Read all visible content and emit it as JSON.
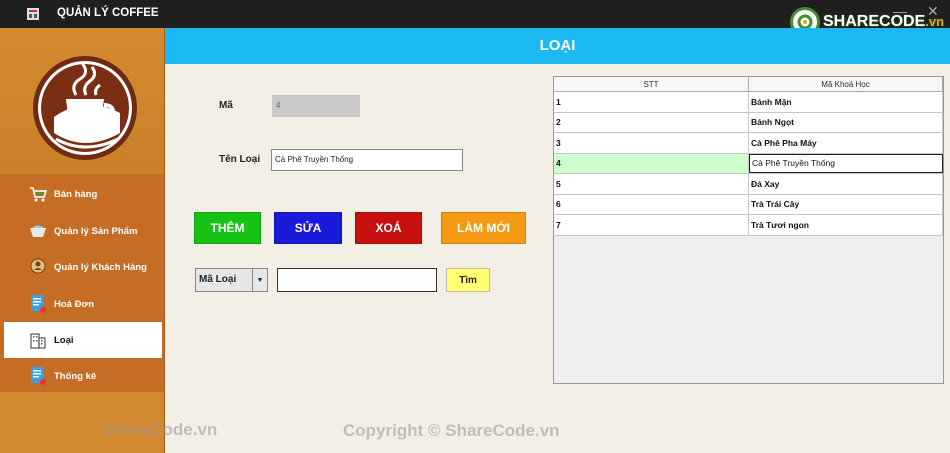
{
  "window": {
    "title": "QUẢN LÝ COFFEE"
  },
  "brand": {
    "logo_text": "SHARECODE",
    "logo_suffix": ".vn"
  },
  "sidebar": {
    "items": [
      {
        "label": "Bán hàng",
        "icon": "cart-icon"
      },
      {
        "label": "Quản lý Sản Phẩm",
        "icon": "bowl-icon"
      },
      {
        "label": "Quản lý Khách Hàng",
        "icon": "user-pin-icon"
      },
      {
        "label": "Hoá Đơn",
        "icon": "invoice-icon"
      },
      {
        "label": "Loại",
        "icon": "building-icon",
        "active": true
      },
      {
        "label": "Thống kê",
        "icon": "report-icon"
      }
    ]
  },
  "header": {
    "title": "LOẠI"
  },
  "form": {
    "ma_label": "Mã",
    "ma_value": "4",
    "ten_loai_label": "Tên Loại",
    "ten_loai_value": "Cà Phê Truyền Thống"
  },
  "buttons": {
    "them": "THÊM",
    "sua": "SỬA",
    "xoa": "XOÁ",
    "lam_moi": "LÀM MỚI"
  },
  "search": {
    "field_selected": "Mã Loại",
    "value": "",
    "find_label": "Tìm"
  },
  "table": {
    "columns": [
      "STT",
      "Mã Khoá Học"
    ],
    "rows": [
      [
        "1",
        "Bánh Mặn"
      ],
      [
        "2",
        "Bánh Ngọt"
      ],
      [
        "3",
        "Cà Phê Pha Máy"
      ],
      [
        "4",
        "Cà Phê Truyền Thống"
      ],
      [
        "5",
        "Đá Xay"
      ],
      [
        "6",
        "Trà Trái Cây"
      ],
      [
        "7",
        "Trà Tươi ngon"
      ]
    ],
    "selected_row": 3
  },
  "watermarks": {
    "left": "ShareCode.vn",
    "center": "Copyright © ShareCode.vn"
  },
  "colors": {
    "header": "#1bb8f2",
    "sidebar": "#c56d24",
    "btn_them": "#16c216",
    "btn_sua": "#1a1adb",
    "btn_xoa": "#c80f0f",
    "btn_lam_moi": "#f59a12",
    "btn_tim": "#ffff70"
  }
}
